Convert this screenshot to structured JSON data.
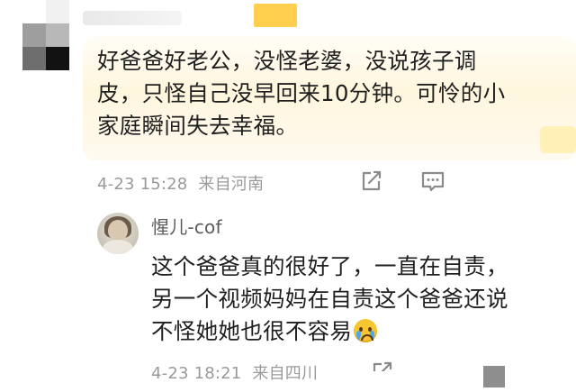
{
  "comment": {
    "lines": [
      "好爸爸好老公，没怪老婆，没说孩子调",
      "皮，只怪自己没早回来10分钟。可怜的小",
      "家庭瞬间失去幸福。"
    ],
    "timestamp": "4-23 15:28",
    "location": "来自河南",
    "share_icon": "share-icon",
    "comment_icon": "comment-icon"
  },
  "reply": {
    "username": "惺儿-cof",
    "lines": [
      "这个爸爸真的很好了，一直在自责，",
      "另一个视频妈妈在自责这个爸爸还说",
      "不怪她她也很不容易"
    ],
    "emoji": "crying-emoji",
    "timestamp": "4-23 18:21",
    "location": "来自四川",
    "share_icon": "share-icon"
  },
  "colors": {
    "text": "#1f1f1f",
    "meta": "#9a9a9a",
    "username": "#5c5c5c",
    "highlight": "#fff6de",
    "accent": "#ffcf4d"
  }
}
